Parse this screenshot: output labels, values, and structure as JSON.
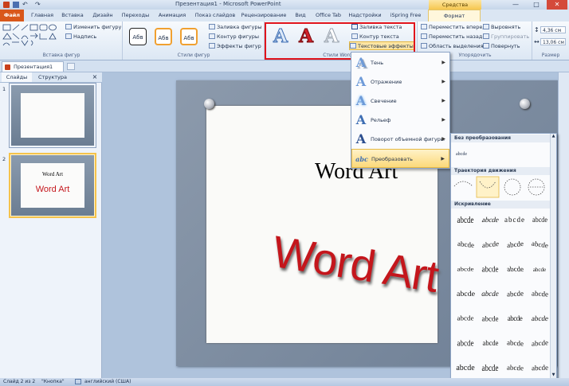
{
  "title_bar": {
    "title": "Презентация1 - Microsoft PowerPoint",
    "context_tools": "Средства рисования",
    "controls": [
      "—",
      "□",
      "✕"
    ]
  },
  "tabs": [
    "Файл",
    "Главная",
    "Вставка",
    "Дизайн",
    "Переходы",
    "Анимация",
    "Показ слайдов",
    "Рецензирование",
    "Вид",
    "Office Tab",
    "Надстройки",
    "iSpring Free",
    "Формат"
  ],
  "ribbon": {
    "insert_shapes": {
      "label": "Вставка фигур",
      "edit_shape": "Изменить фигуру",
      "text_box": "Надпись"
    },
    "shape_styles": {
      "label": "Стили фигур",
      "sample": "Абв",
      "fill": "Заливка фигуры",
      "outline": "Контур фигуры",
      "effects": "Эффекты фигур"
    },
    "wordart_styles": {
      "label": "Стили WordArt",
      "glyph": "A",
      "text_fill": "Заливка текста",
      "text_outline": "Контур текста",
      "text_effects": "Текстовые эффекты"
    },
    "arrange": {
      "label": "Упорядочить",
      "bring_forward": "Переместить вперед",
      "send_backward": "Переместить назад",
      "selection_pane": "Область выделения",
      "align": "Выровнять",
      "group": "Группировать",
      "rotate": "Повернуть"
    },
    "size": {
      "label": "Размер",
      "height": "4,36 см",
      "width": "13,06 см"
    }
  },
  "doc_tab": "Презентация1",
  "left_pane": {
    "tabs": [
      "Слайды",
      "Структура"
    ],
    "slides": [
      {
        "number": "1",
        "title": "",
        "body": ""
      },
      {
        "number": "2",
        "title": "Word Art",
        "body": "Word Art"
      }
    ]
  },
  "slide": {
    "title": "Word Art",
    "wordart": "Word Art"
  },
  "text_effects_menu": [
    {
      "label": "Тень",
      "icon": "A"
    },
    {
      "label": "Отражение",
      "icon": "A"
    },
    {
      "label": "Свечение",
      "icon": "A"
    },
    {
      "label": "Рельеф",
      "icon": "A"
    },
    {
      "label": "Поворот объемной фигуры",
      "icon": "A"
    },
    {
      "label": "Преобразовать",
      "icon": "abc"
    }
  ],
  "transform_flyout": {
    "no_transform_header": "Без преобразования",
    "no_transform_sample": "abcde",
    "follow_path_header": "Траектория движения",
    "warp_header": "Искривление",
    "warp_sample": "abcde"
  },
  "status_bar": {
    "slide": "Слайд 2 из 2",
    "theme": "\"Кнопка\"",
    "language": "английский (США)"
  },
  "colors": {
    "accent_file_tab": "#d9571a",
    "highlight_box": "#e0141c",
    "wordart_red": "#c4161c",
    "menu_hover": "#fcd97a"
  }
}
